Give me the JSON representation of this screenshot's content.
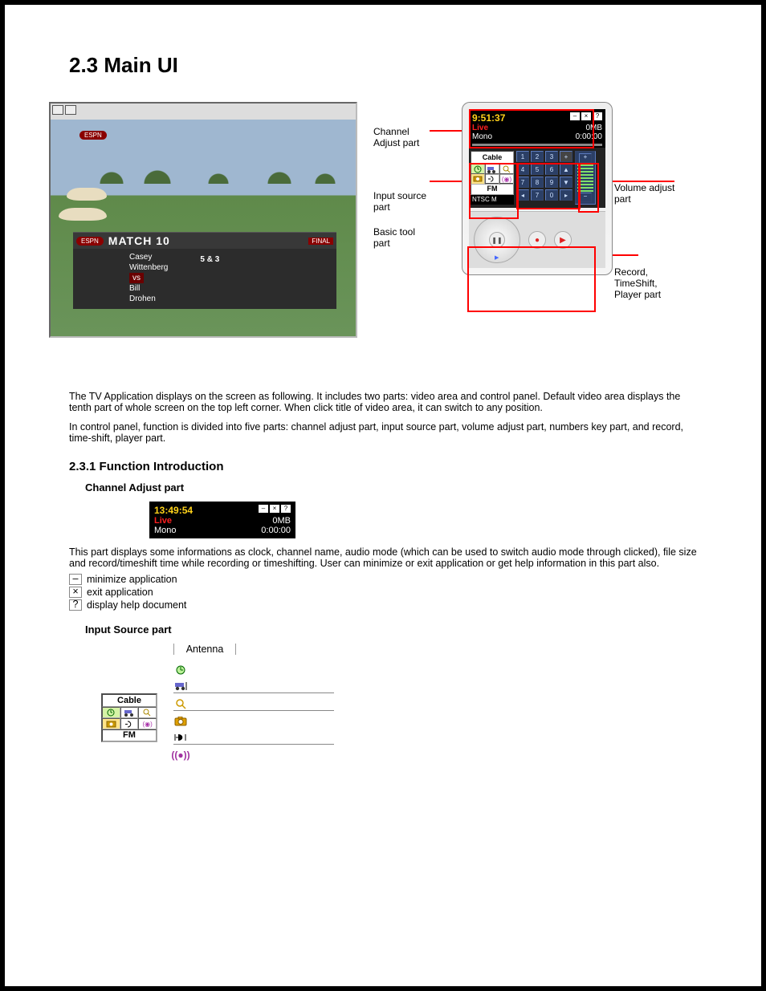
{
  "headings": {
    "main_section": "2.3 Main UI",
    "function_section": "2.3.1 Function Introduction",
    "channel_adj_heading": "Channel Adjust part",
    "input_source_heading": "Input Source part"
  },
  "paragraphs": {
    "intro1": "The TV Application displays on the screen as following. It includes two parts: video area and control panel. Default video area displays the tenth part of whole screen on the top left corner. When click title of video area, it can switch to any position.",
    "intro2": "In control panel, function is divided into five parts: channel adjust part, input source part, volume adjust part, numbers key part, and record, time-shift, player part.",
    "channel_adj_desc": "This part displays some informations as clock, channel name, audio mode (which can be used to switch audio mode through clicked), file size and record/timeshift time while recording or timeshifting. User can minimize or exit application or get help information in this part also.",
    "input_source_desc": ""
  },
  "callouts": {
    "ch_adjust": "Channel\nAdjust part",
    "input_source": "Input source\npart",
    "basic_tool": "Basic tool\npart",
    "volume": "Volume adjust\npart",
    "record": "Record,\nTimeShift,\nPlayer part"
  },
  "remote_lcd": {
    "time": "9:51:37",
    "status": "Live",
    "audio": "Mono",
    "size": "0MB",
    "elapsed": "0:00:00"
  },
  "lcd_standalone": {
    "time": "13:49:54",
    "status": "Live",
    "audio": "Mono",
    "size": "0MB",
    "elapsed": "0:00:00"
  },
  "source_labels": {
    "cable": "Cable",
    "fm": "FM",
    "ntsc": "NTSC M",
    "antenna": "Antenna"
  },
  "source_icons": {
    "clock_desc": "Schedule record tool",
    "car_desc": "AutoScan tool",
    "zoom_desc": "Zoom tool",
    "camera_desc": "Snapshot tool",
    "arrow_desc": "Video desktop tool",
    "radio_desc": "FM radio tool"
  },
  "keypad": {
    "nums": [
      "1",
      "2",
      "3",
      "4",
      "5",
      "6",
      "7",
      "8",
      "9",
      "0"
    ],
    "channel_display": "7"
  },
  "video_overlay": {
    "network": "ESPN",
    "match_title": "MATCH 10",
    "final_tag": "FINAL",
    "player1a": "Casey",
    "player1b": "Wittenberg",
    "vs": "vs",
    "player2a": "Bill",
    "player2b": "Drohen",
    "score": "5 & 3"
  },
  "help_bullets": {
    "min": "minimize application",
    "exit": "exit application",
    "help": "display help document"
  }
}
